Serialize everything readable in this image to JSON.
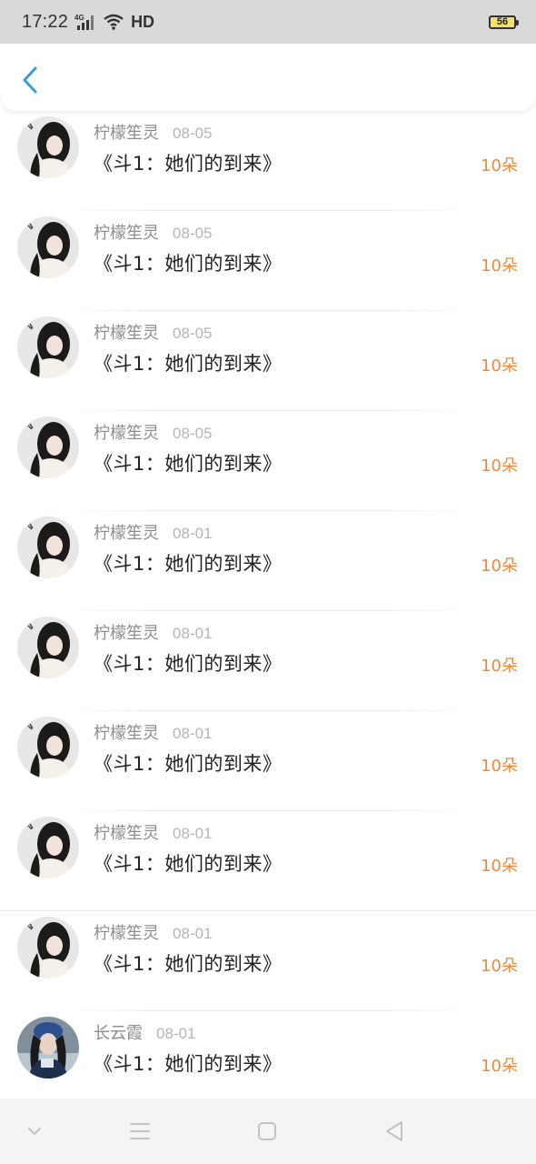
{
  "status_bar": {
    "time": "17:22",
    "network": "4G",
    "hd": "HD",
    "battery": "56"
  },
  "header": {
    "back_icon": "chevron-left-icon"
  },
  "colors": {
    "accent_blue": "#3a9be0",
    "amount_orange": "#f0883a"
  },
  "records": [
    {
      "name": "柠檬笙灵",
      "date": "08-05",
      "title": "《斗1：她们的到来》",
      "amount": "10朵",
      "avatar": "girl-avatar"
    },
    {
      "name": "柠檬笙灵",
      "date": "08-05",
      "title": "《斗1：她们的到来》",
      "amount": "10朵",
      "avatar": "girl-avatar"
    },
    {
      "name": "柠檬笙灵",
      "date": "08-05",
      "title": "《斗1：她们的到来》",
      "amount": "10朵",
      "avatar": "girl-avatar"
    },
    {
      "name": "柠檬笙灵",
      "date": "08-05",
      "title": "《斗1：她们的到来》",
      "amount": "10朵",
      "avatar": "girl-avatar"
    },
    {
      "name": "柠檬笙灵",
      "date": "08-01",
      "title": "《斗1：她们的到来》",
      "amount": "10朵",
      "avatar": "girl-avatar"
    },
    {
      "name": "柠檬笙灵",
      "date": "08-01",
      "title": "《斗1：她们的到来》",
      "amount": "10朵",
      "avatar": "girl-avatar"
    },
    {
      "name": "柠檬笙灵",
      "date": "08-01",
      "title": "《斗1：她们的到来》",
      "amount": "10朵",
      "avatar": "girl-avatar"
    },
    {
      "name": "柠檬笙灵",
      "date": "08-01",
      "title": "《斗1：她们的到来》",
      "amount": "10朵",
      "avatar": "girl-avatar"
    },
    {
      "name": "柠檬笙灵",
      "date": "08-01",
      "title": "《斗1：她们的到来》",
      "amount": "10朵",
      "avatar": "girl-avatar"
    },
    {
      "name": "长云霞",
      "date": "08-01",
      "title": "《斗1：她们的到来》",
      "amount": "10朵",
      "avatar": "winter-avatar"
    }
  ],
  "nav_bar": {
    "buttons": [
      "collapse-icon",
      "menu-icon",
      "home-icon",
      "back-triangle-icon"
    ]
  }
}
